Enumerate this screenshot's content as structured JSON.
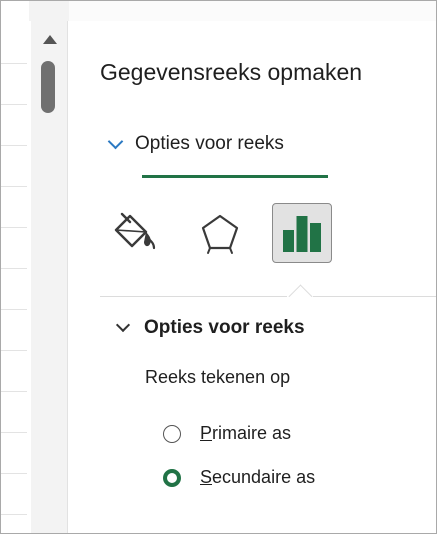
{
  "pane": {
    "title": "Gegevensreeks opmaken",
    "tab_label": "Opties voor reeks",
    "icon_tabs": [
      {
        "name": "fill-line-icon",
        "selected": false
      },
      {
        "name": "effects-pentagon-icon",
        "selected": false
      },
      {
        "name": "series-options-bar-chart-icon",
        "selected": true
      }
    ]
  },
  "section": {
    "heading": "Opties voor reeks",
    "plot_on_label": "Reeks tekenen op",
    "options": [
      {
        "accel": "P",
        "rest": "rimaire as",
        "selected": false
      },
      {
        "accel": "S",
        "rest": "ecundaire as",
        "selected": true
      }
    ]
  },
  "colors": {
    "accent_green": "#217346",
    "chevron_blue": "#2b79c2"
  }
}
